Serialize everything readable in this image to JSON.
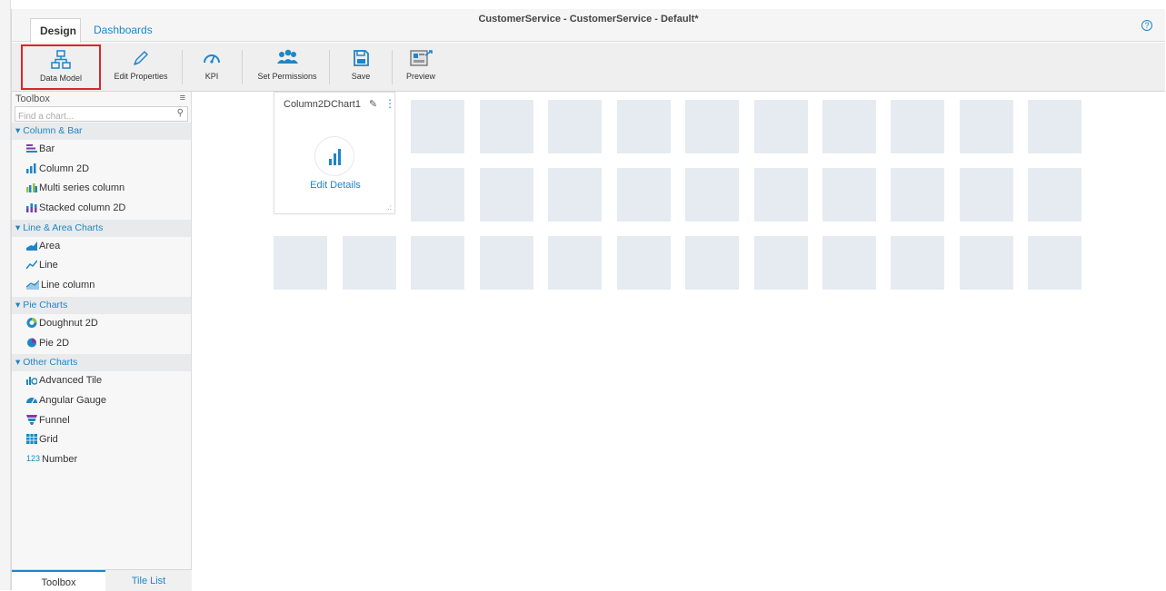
{
  "header": {
    "tabs": [
      {
        "label": "Design"
      },
      {
        "label": "Dashboards"
      }
    ],
    "title": "CustomerService - CustomerService - Default*",
    "help_icon": "help-circle-icon"
  },
  "ribbon": {
    "buttons": [
      {
        "label": "Data Model",
        "icon": "data-model-icon",
        "selected": true
      },
      {
        "label": "Edit Properties",
        "icon": "pencil-icon"
      },
      {
        "label": "KPI",
        "icon": "gauge-icon"
      },
      {
        "label": "Set Permissions",
        "icon": "users-icon"
      },
      {
        "label": "Save",
        "icon": "floppy-icon"
      },
      {
        "label": "Preview",
        "icon": "preview-icon"
      }
    ]
  },
  "sidebar": {
    "title": "Toolbox",
    "search_placeholder": "Find a chart...",
    "groups": [
      {
        "label": "▾ Column & Bar",
        "items": [
          "Bar",
          "Column 2D",
          "Multi series column",
          "Stacked column 2D"
        ]
      },
      {
        "label": "▾ Line & Area Charts",
        "items": [
          "Area",
          "Line",
          "Line column"
        ]
      },
      {
        "label": "▾ Pie Charts",
        "items": [
          "Doughnut 2D",
          "Pie 2D"
        ]
      },
      {
        "label": "▾ Other Charts",
        "items": [
          "Advanced Tile",
          "Angular Gauge",
          "Funnel",
          "Grid",
          "Number"
        ]
      }
    ],
    "bottom_tabs": [
      {
        "label": "Toolbox"
      },
      {
        "label": "Tile List"
      }
    ]
  },
  "canvas": {
    "chart_tile": {
      "title": "Column2DChart1",
      "action": "Edit Details"
    }
  },
  "colors": {
    "accent": "#1e86c7",
    "selected_border": "#d9262b",
    "tile": "#e6ebf1"
  }
}
